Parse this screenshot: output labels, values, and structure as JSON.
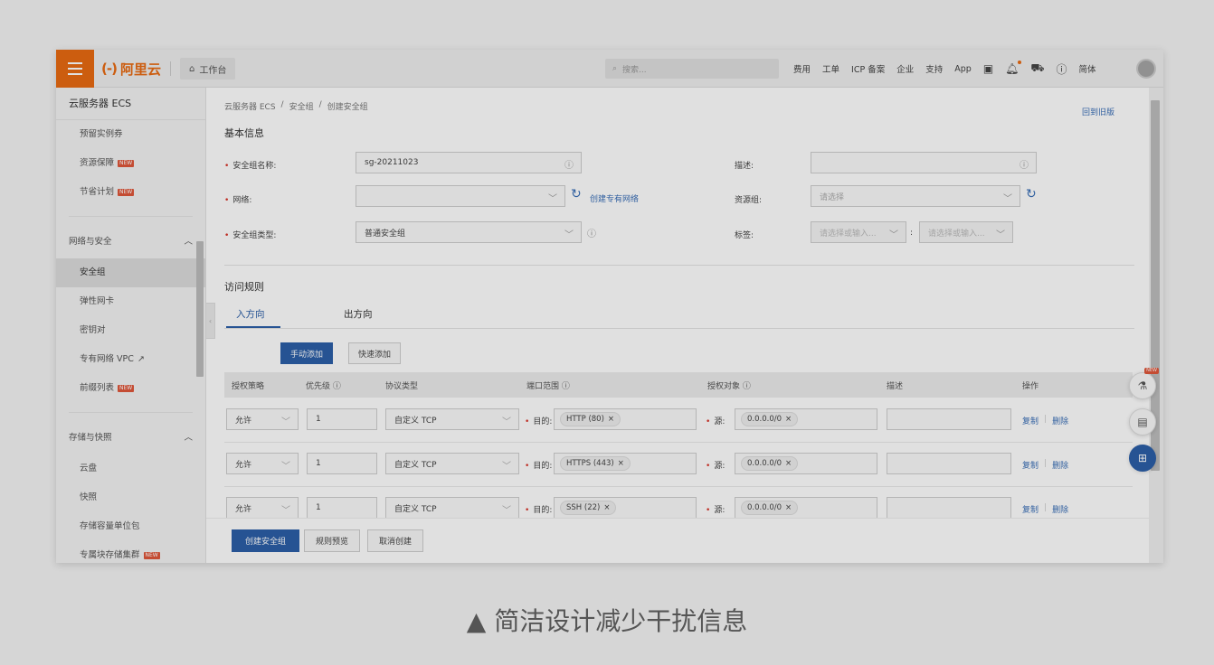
{
  "topbar": {
    "logo_text": "阿里云",
    "logo_mark": "(-)",
    "workbench": "工作台",
    "search_placeholder": "搜索...",
    "nav": [
      "费用",
      "工单",
      "ICP 备案",
      "企业",
      "支持",
      "App"
    ],
    "lang": "简体"
  },
  "sidebar": {
    "title": "云服务器 ECS",
    "top_items": [
      {
        "label": "预留实例券",
        "badge": ""
      },
      {
        "label": "资源保障",
        "badge": "NEW"
      },
      {
        "label": "节省计划",
        "badge": "NEW"
      }
    ],
    "group1": "网络与安全",
    "group1_items": [
      {
        "label": "安全组",
        "badge": ""
      },
      {
        "label": "弹性网卡",
        "badge": ""
      },
      {
        "label": "密钥对",
        "badge": ""
      },
      {
        "label": "专有网络 VPC",
        "badge": ""
      },
      {
        "label": "前缀列表",
        "badge": "NEW"
      }
    ],
    "group2": "存储与快照",
    "group2_items": [
      {
        "label": "云盘",
        "badge": ""
      },
      {
        "label": "快照",
        "badge": ""
      },
      {
        "label": "存储容量单位包",
        "badge": ""
      },
      {
        "label": "专属块存储集群",
        "badge": "NEW"
      }
    ]
  },
  "breadcrumb": [
    "云服务器 ECS",
    "安全组",
    "创建安全组"
  ],
  "back_link": "回到旧版",
  "basic": {
    "title": "基本信息",
    "name_label": "安全组名称:",
    "name_value": "sg-20211023",
    "network_label": "网络:",
    "network_value": "",
    "create_vpc": "创建专有网络",
    "type_label": "安全组类型:",
    "type_value": "普通安全组",
    "desc_label": "描述:",
    "desc_value": "",
    "rg_label": "资源组:",
    "rg_placeholder": "请选择",
    "tag_label": "标签:",
    "tag_key_placeholder": "请选择或输入...",
    "tag_value_placeholder": "请选择或输入...",
    "tag_sep": ":"
  },
  "rules": {
    "title": "访问规则",
    "tabs": [
      "入方向",
      "出方向"
    ],
    "add_manual": "手动添加",
    "add_quick": "快速添加",
    "headers": [
      "授权策略",
      "优先级",
      "协议类型",
      "端口范围",
      "授权对象",
      "描述",
      "操作"
    ],
    "dest_label": "目的:",
    "src_label": "源:",
    "copy": "复制",
    "delete": "删除",
    "rows": [
      {
        "policy": "允许",
        "priority": "1",
        "protocol": "自定义 TCP",
        "port": "HTTP (80)",
        "source": "0.0.0.0/0"
      },
      {
        "policy": "允许",
        "priority": "1",
        "protocol": "自定义 TCP",
        "port": "HTTPS (443)",
        "source": "0.0.0.0/0"
      },
      {
        "policy": "允许",
        "priority": "1",
        "protocol": "自定义 TCP",
        "port": "SSH (22)",
        "source": "0.0.0.0/0"
      }
    ]
  },
  "footer": {
    "create": "创建安全组",
    "preview": "规则预览",
    "cancel": "取消创建"
  },
  "float_badge": "NEW",
  "caption": "▲ 简洁设计减少干扰信息"
}
